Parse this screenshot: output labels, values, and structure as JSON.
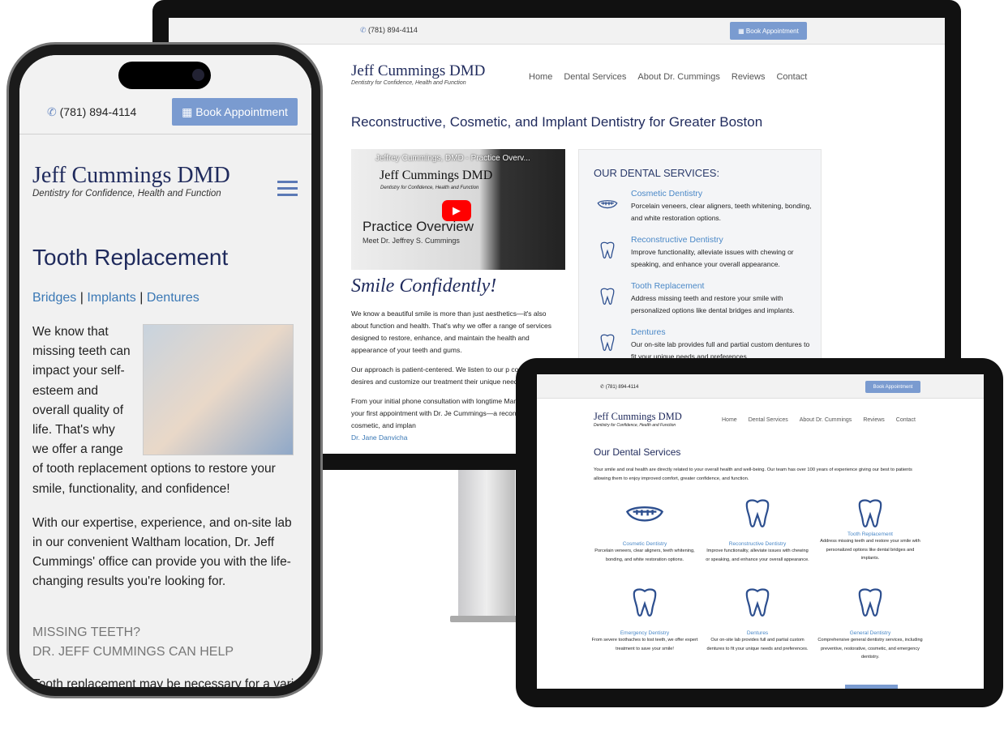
{
  "site": {
    "logo_name": "Jeff Cummings DMD",
    "tagline": "Dentistry for Confidence, Health and Function",
    "phone": "(781) 894-4114",
    "book_label": "Book Appointment",
    "nav": [
      "Home",
      "Dental Services",
      "About Dr. Cummings",
      "Reviews",
      "Contact"
    ],
    "accent": "#7a9bd0",
    "link_color": "#3a78b5",
    "heading_color": "#1f2a5c"
  },
  "desktop": {
    "headline": "Reconstructive, Cosmetic, and Implant Dentistry for Greater Boston",
    "video": {
      "title": "Jeffrey Cummings, DMD - Practice Overv...",
      "logo": "Jeff Cummings DMD",
      "tagline": "Dentistry for Confidence, Health and Function",
      "heading": "Practice Overview",
      "sub": "Meet Dr. Jeffrey S. Cummings"
    },
    "script_heading": "Smile Confidently!",
    "paragraphs": [
      "We know a beautiful smile is more than just aesthetics—it's also about function and health. That's why we offer a range of services designed to restore, enhance, and maintain the health and appearance of your teeth and gums.",
      "Our approach is patient-centered. We listen to our p concerns and desires and customize our treatment their unique needs and goals.",
      "From your initial phone consultation with longtime Manager Sally to your first appointment with Dr. Je Cummings—a reconstructive, cosmetic, and implan"
    ],
    "link_text": "Dr. Jane Danvicha",
    "services_heading": "OUR DENTAL SERVICES:",
    "services": [
      {
        "title": "Cosmetic Dentistry",
        "desc": "Porcelain veneers, clear aligners, teeth whitening, bonding, and white restoration options.",
        "icon": "smile-icon"
      },
      {
        "title": "Reconstructive Dentistry",
        "desc": "Improve functionality, alleviate issues with chewing or speaking, and enhance your overall appearance.",
        "icon": "tooth-icon"
      },
      {
        "title": "Tooth Replacement",
        "desc": "Address missing teeth and restore your smile with personalized options like dental bridges and implants.",
        "icon": "implant-icon"
      },
      {
        "title": "Dentures",
        "desc": "Our on-site lab provides full and partial custom dentures to fit your unique needs and preferences.",
        "icon": "dentures-icon"
      }
    ]
  },
  "tablet": {
    "heading": "Our Dental Services",
    "intro": "Your smile and oral health are directly related to your overall health and well-being.  Our team has over 100 years of experience giving our best to patients allowing them to enjoy improved comfort, greater confidence, and function.",
    "services": [
      {
        "title": "Cosmetic Dentistry",
        "desc": "Porcelain veneers, clear aligners, teeth whitening, bonding, and white restoration options."
      },
      {
        "title": "Reconstructive Dentistry",
        "desc": "Improve functionality, alleviate issues with chewing or speaking, and enhance your overall appearance."
      },
      {
        "title": "Tooth Replacement",
        "desc": "Address missing teeth and restore your smile with personalized options like dental bridges and implants."
      },
      {
        "title": "Emergency Dentistry",
        "desc": "From severe toothaches to lost teeth, we offer expert treatment to save your smile!"
      },
      {
        "title": "Dentures",
        "desc": "Our on-site lab provides full and partial custom dentures to fit your unique needs and preferences."
      },
      {
        "title": "General Dentistry",
        "desc": "Comprehensive general dentistry services, including preventive, restorative, cosmetic, and emergency dentistry."
      }
    ]
  },
  "phone": {
    "page_title": "Tooth Replacement",
    "links": [
      "Bridges",
      "Implants",
      "Dentures"
    ],
    "sep": "|",
    "intro": "We know that missing teeth can impact your self-esteem and overall quality of life. That's why we offer a range of tooth replacement options to restore your smile, functionality, and confidence!",
    "para2": "With our expertise, experience, and on-site lab in our convenient Waltham location, Dr. Jeff Cummings' office can provide you with the life-changing results you're looking for.",
    "subhead1": "MISSING TEETH?",
    "subhead2": "DR. JEFF CUMMINGS CAN HELP",
    "para3": "Tooth replacement may be necessary for a variety"
  }
}
